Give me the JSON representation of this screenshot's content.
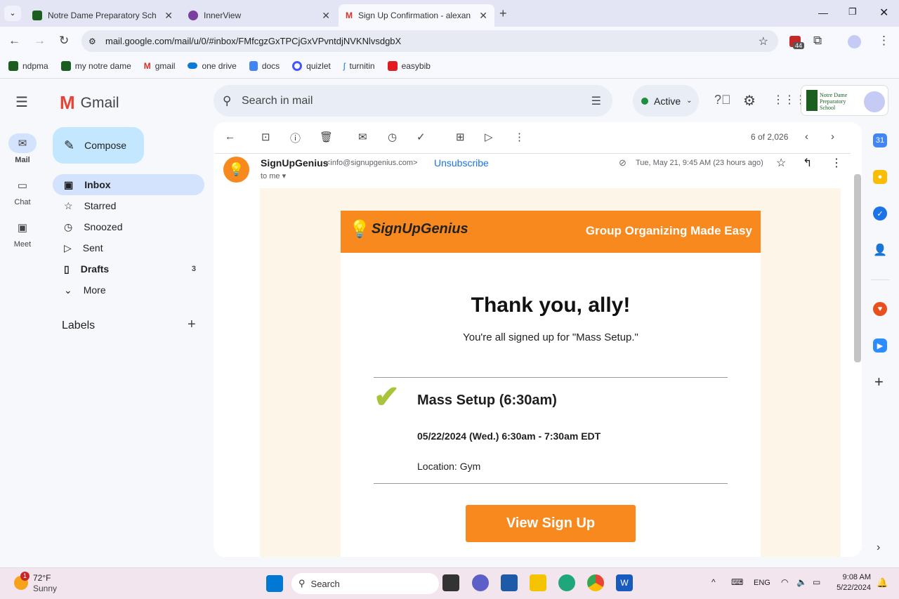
{
  "browser": {
    "tabs": [
      {
        "title": "Notre Dame Preparatory School"
      },
      {
        "title": "InnerView"
      },
      {
        "title": "Sign Up Confirmation - alexand"
      }
    ],
    "url": "mail.google.com/mail/u/0/#inbox/FMfcgzGxTPCjGxVPvntdjNVKNlvsdgbX",
    "extension_badge": "44",
    "bookmarks": [
      "ndpma",
      "my notre dame",
      "gmail",
      "one drive",
      "docs",
      "quizlet",
      "turnitin",
      "easybib"
    ]
  },
  "gmail": {
    "logo": "Gmail",
    "search_placeholder": "Search in mail",
    "status": "Active",
    "rail": [
      {
        "label": "Mail"
      },
      {
        "label": "Chat"
      },
      {
        "label": "Meet"
      }
    ],
    "compose": "Compose",
    "nav": [
      {
        "label": "Inbox"
      },
      {
        "label": "Starred"
      },
      {
        "label": "Snoozed"
      },
      {
        "label": "Sent"
      },
      {
        "label": "Drafts",
        "count": "3"
      },
      {
        "label": "More"
      }
    ],
    "labels_heading": "Labels",
    "school_logo": "Notre Dame Preparatory School",
    "pagination": "6 of 2,026"
  },
  "email": {
    "sender": "SignUpGenius",
    "sender_email": "<info@signupgenius.com>",
    "unsubscribe": "Unsubscribe",
    "date": "Tue, May 21, 9:45 AM (23 hours ago)",
    "to": "to me",
    "banner_logo": "SignUpGenius",
    "banner_tagline": "Group Organizing Made Easy",
    "heading": "Thank you, ally!",
    "subheading": "You're all signed up for \"Mass Setup.\"",
    "slot_title": "Mass Setup (6:30am)",
    "slot_time": "05/22/2024 (Wed.) 6:30am - 7:30am EDT",
    "location": "Location: Gym",
    "button": "View Sign Up"
  },
  "taskbar": {
    "weather_temp": "72°F",
    "weather_desc": "Sunny",
    "weather_badge": "1",
    "search": "Search",
    "lang": "ENG",
    "time": "9:08 AM",
    "date": "5/22/2024"
  },
  "colors": {
    "brand_orange": "#f7891f",
    "check_green": "#a8c43a",
    "compose_bg": "#c2e7ff",
    "selected_nav": "#d3e3fd"
  }
}
